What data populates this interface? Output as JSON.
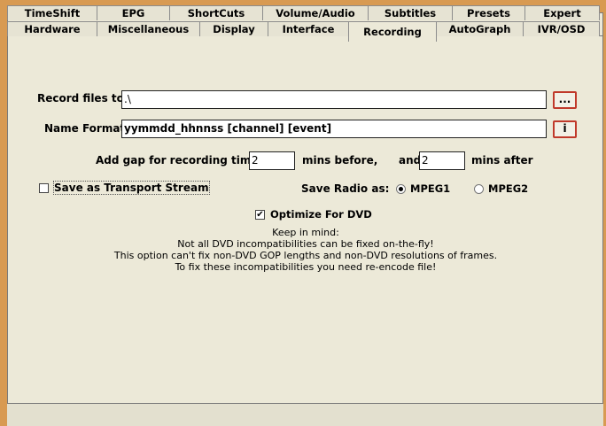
{
  "tabs_row1": [
    "TimeShift",
    "EPG",
    "ShortCuts",
    "Volume/Audio",
    "Subtitles",
    "Presets",
    "Expert"
  ],
  "tabs_row2": [
    "Hardware",
    "Miscellaneous",
    "Display",
    "Interface",
    "Recording",
    "AutoGraph",
    "IVR/OSD"
  ],
  "active_tab": "Recording",
  "record_files": {
    "label": "Record files to",
    "value": ".\\",
    "browse_label": "..."
  },
  "name_format": {
    "label": "Name Format",
    "value": "yymmdd_hhnnss [channel] [event]",
    "info_label": "i"
  },
  "gap": {
    "label": "Add gap for recording time",
    "before_value": "2",
    "before_suffix": "mins before,",
    "and_label": "and",
    "after_value": "2",
    "after_suffix": "mins after"
  },
  "transport_stream": {
    "label": "Save as Transport Stream",
    "checked": false
  },
  "save_radio": {
    "label": "Save Radio as:",
    "options": [
      "MPEG1",
      "MPEG2"
    ],
    "selected": "MPEG1"
  },
  "optimize_dvd": {
    "label": "Optimize For DVD",
    "checked": true,
    "check_glyph": "✔"
  },
  "notes": [
    "Keep in mind:",
    "Not all DVD incompatibilities can be fixed on-the-fly!",
    "This option can't fix non-DVD GOP lengths and non-DVD resolutions of frames.",
    "To fix these incompatibilities you need re-encode file!"
  ]
}
